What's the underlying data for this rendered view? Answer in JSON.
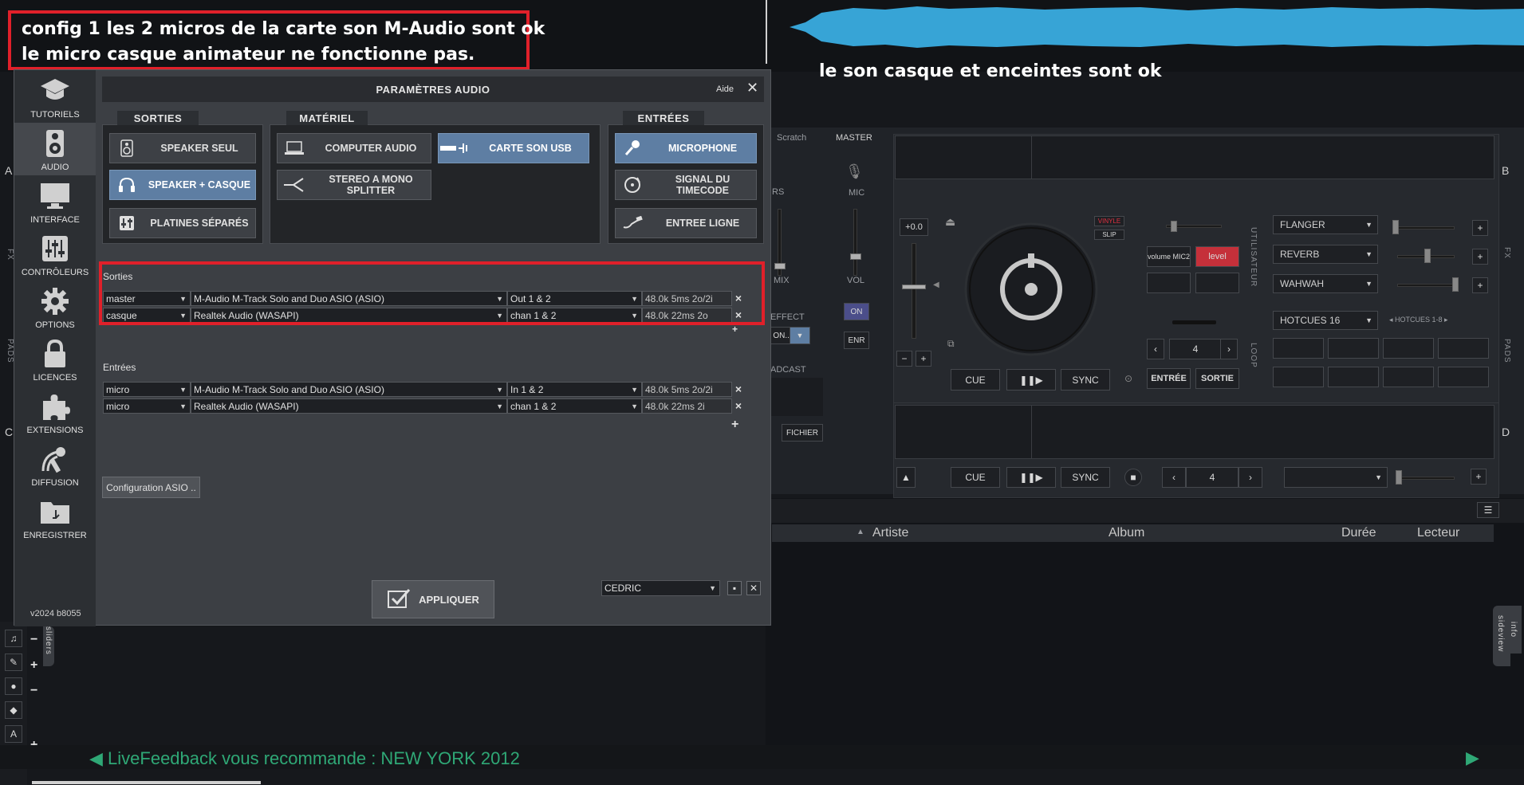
{
  "annotations": {
    "line1": "config 1 les 2 micros de la carte son M-Audio sont ok",
    "line2": "le micro casque animateur ne fonctionne pas.",
    "right_note": "le son casque et enceintes sont ok"
  },
  "dialog": {
    "title": "PARAMÈTRES AUDIO",
    "help": "Aide",
    "close": "✕",
    "version": "v2024 b8055",
    "nav": [
      {
        "label": "TUTORIELS",
        "icon": "graduation-cap-icon"
      },
      {
        "label": "AUDIO",
        "icon": "speaker-icon"
      },
      {
        "label": "INTERFACE",
        "icon": "monitor-icon"
      },
      {
        "label": "CONTRÔLEURS",
        "icon": "sliders-icon"
      },
      {
        "label": "OPTIONS",
        "icon": "gear-icon"
      },
      {
        "label": "LICENCES",
        "icon": "lock-icon"
      },
      {
        "label": "EXTENSIONS",
        "icon": "puzzle-icon"
      },
      {
        "label": "DIFFUSION",
        "icon": "broadcast-icon"
      },
      {
        "label": "ENREGISTRER",
        "icon": "folder-icon"
      }
    ],
    "groups": {
      "sorties": {
        "title": "SORTIES",
        "buttons": [
          "SPEAKER SEUL",
          "SPEAKER + CASQUE",
          "PLATINES SÉPARÉS"
        ]
      },
      "materiel": {
        "title": "MATÉRIEL",
        "buttons": [
          "COMPUTER AUDIO",
          "CARTE SON USB",
          "STEREO A MONO SPLITTER"
        ]
      },
      "entrees": {
        "title": "ENTRÉES",
        "buttons": [
          "MICROPHONE",
          "SIGNAL DU TIMECODE",
          "ENTREE LIGNE"
        ]
      }
    },
    "outputs_label": "Sorties",
    "outputs": [
      {
        "name": "master",
        "device": "M-Audio M-Track Solo and Duo ASIO (ASIO)",
        "channel": "Out 1 & 2",
        "info": "48.0k 5ms 2o/2i"
      },
      {
        "name": "casque",
        "device": "Realtek Audio (WASAPI)",
        "channel": "chan 1 & 2",
        "info": "48.0k 22ms 2o"
      }
    ],
    "inputs_label": "Entrées",
    "inputs": [
      {
        "name": "micro",
        "device": "M-Audio M-Track Solo and Duo ASIO (ASIO)",
        "channel": "In 1 & 2",
        "info": "48.0k 5ms 2o/2i"
      },
      {
        "name": "micro",
        "device": "Realtek Audio (WASAPI)",
        "channel": "chan 1 & 2",
        "info": "48.0k 22ms 2i"
      }
    ],
    "asio_button": "Configuration ASIO ..",
    "apply_button": "APPLIQUER",
    "profile": "CEDRIC",
    "remove_symbol": "×",
    "add_symbol": "+"
  },
  "background": {
    "tabs": [
      "Scratch",
      "MASTER"
    ],
    "mixer": {
      "mic": "MIC",
      "vol": "VOL",
      "mix": "MIX",
      "on": "ON",
      "enr": "ENR",
      "fichier": "FICHIER",
      "effect": "EFFECT",
      "broadcast": "ADCAST",
      "rs": "RS",
      "on_truncated": "ON..."
    },
    "deck_b": {
      "letter": "B",
      "pitch": "+0.0",
      "vinyle": "VINYLE",
      "slip": "SLIP",
      "volume_mic2": "volume MIC2",
      "level": "level",
      "effects": [
        "FLANGER",
        "REVERB",
        "WAHWAH"
      ],
      "hotcues": "HOTCUES 16",
      "hotcues_range": "HOTCUES 1-8",
      "loop_value": "4",
      "cue": "CUE",
      "play": "❚❚▶",
      "sync": "SYNC",
      "entree": "ENTRÉE",
      "sortie": "SORTIE",
      "side_labels": {
        "utilisateur": "UTILISATEUR",
        "loop": "LOOP",
        "fx": "FX",
        "pads": "PADS"
      }
    },
    "deck_d": {
      "letter": "D",
      "cue": "CUE",
      "play": "❚❚▶",
      "sync": "SYNC",
      "loop_value": "4"
    },
    "left_letters": {
      "a": "A",
      "c": "C"
    },
    "left_labels": {
      "fx": "FX",
      "pads": "PADS"
    },
    "browser_columns": [
      "Artiste",
      "Album",
      "Durée",
      "Lecteur"
    ],
    "side_tabs": {
      "sideview": "sideview",
      "info": "info",
      "sliders": "sliders"
    },
    "recommendation": "◀ LiveFeedback vous recommande : NEW YORK 2012",
    "next_arrow": "▶",
    "plus": "+",
    "minus": "−"
  }
}
